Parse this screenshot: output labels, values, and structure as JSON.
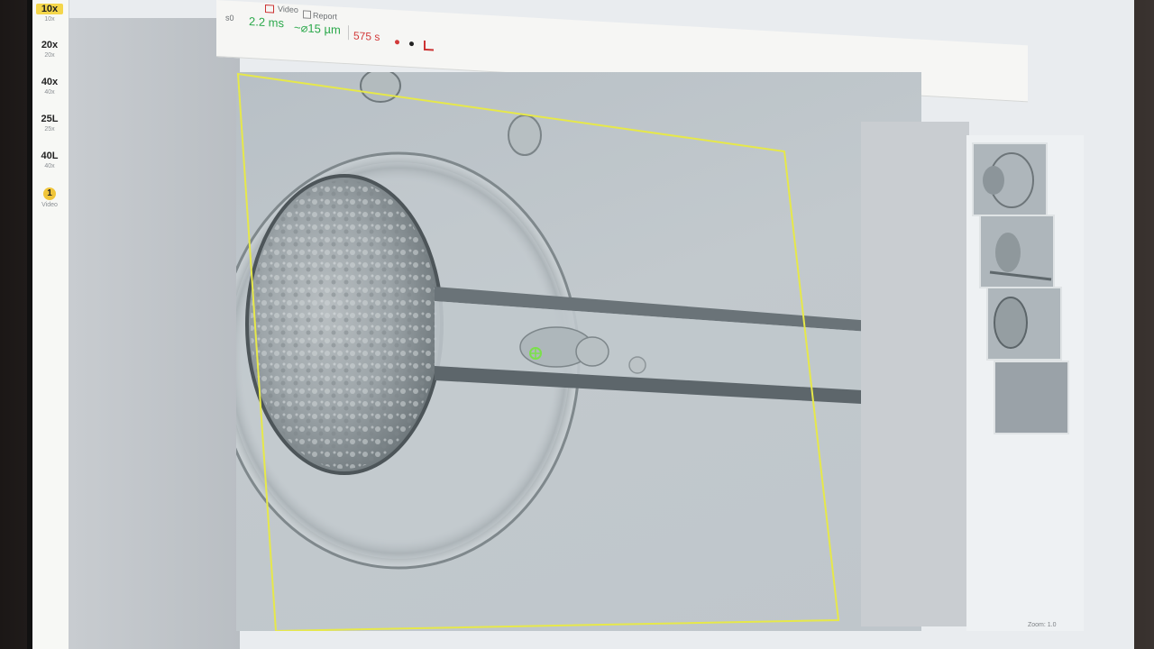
{
  "magnifications": [
    {
      "label": "10x",
      "sub": "10x",
      "active": true
    },
    {
      "label": "20x",
      "sub": "20x",
      "active": false
    },
    {
      "label": "40x",
      "sub": "40x",
      "active": false
    },
    {
      "label": "25L",
      "sub": "25x",
      "active": false
    },
    {
      "label": "40L",
      "sub": "40x",
      "active": false
    }
  ],
  "video": {
    "number": "1",
    "label": "Video"
  },
  "toolbar": {
    "video_tab": "Video",
    "report_tab": "Report",
    "pulse_duration": "2.2 ms",
    "hole_size": "~⌀15 µm",
    "timer": "575 s",
    "unit_small": "s0"
  },
  "colors": {
    "accent_yellow": "#f4d64a",
    "frame_yellow": "#e6e84a",
    "pulse_green": "#2aa84a",
    "timer_red": "#d23a3a",
    "target_green": "#7be04a"
  },
  "icons": [
    "film-icon",
    "report-icon",
    "record-dot-icon",
    "stop-dot-icon",
    "chart-icon",
    "crosshair-icon"
  ],
  "statusbar": {
    "zoom": "Zoom: 1.0"
  }
}
